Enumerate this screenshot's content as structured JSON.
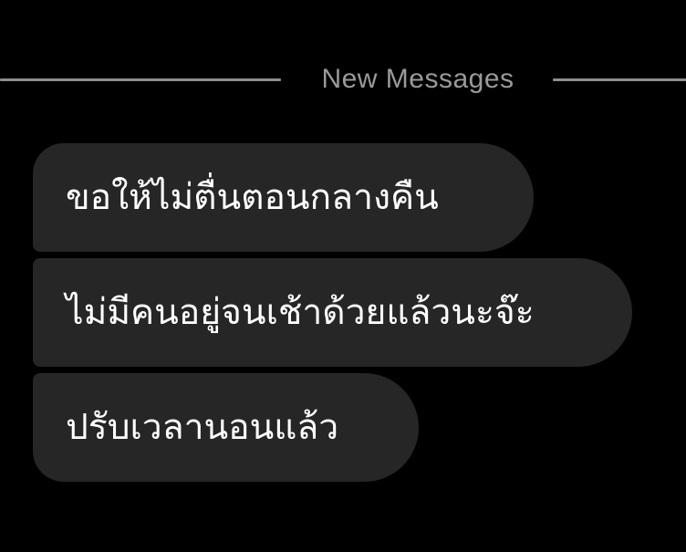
{
  "divider": {
    "label": "New Messages",
    "line_color": "#8e8e8e",
    "label_color": "#9a9a9a"
  },
  "messages": [
    {
      "text": "ขอให้ไม่ตื่นตอนกลางคืน"
    },
    {
      "text": "ไม่มีคนอยู่จนเช้าด้วยแล้วนะจ๊ะ"
    },
    {
      "text": "ปรับเวลานอนแล้ว"
    }
  ],
  "colors": {
    "background": "#000000",
    "bubble": "#262626",
    "bubble_text": "#ffffff"
  }
}
